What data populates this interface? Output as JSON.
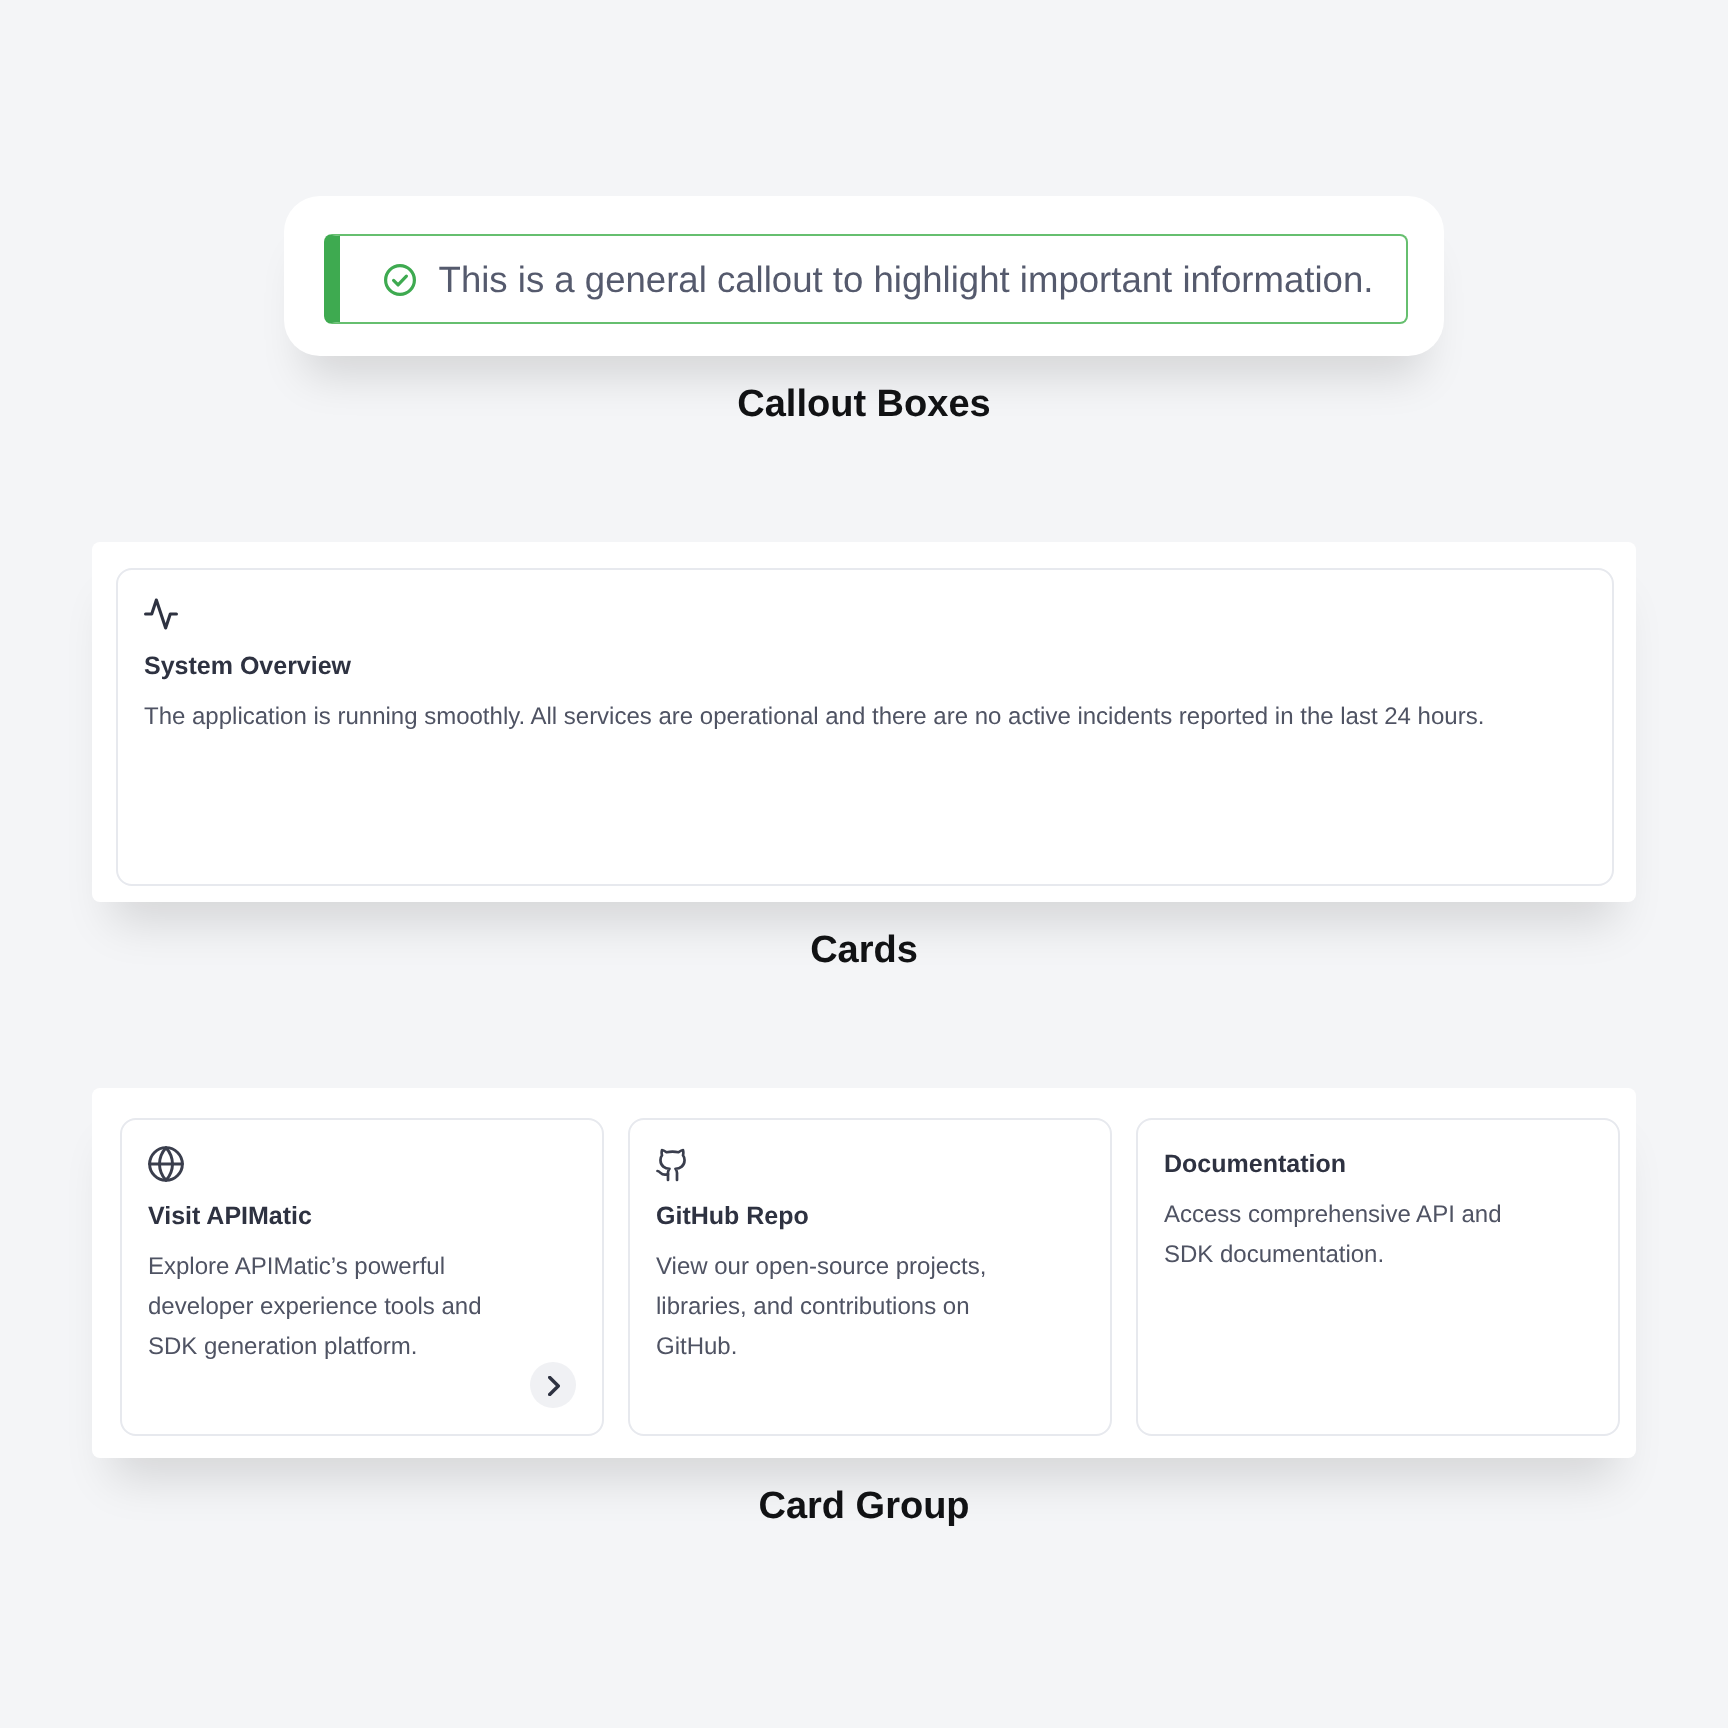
{
  "callout_demo": {
    "callout": {
      "kind": "success",
      "text": "This is a general callout to highlight important information."
    },
    "caption": "Callout Boxes"
  },
  "card_demo": {
    "card": {
      "kind": "status",
      "title": "System Overview",
      "description": "The application is running smoothly. All services are operational and there are no active incidents reported in the last 24 hours."
    },
    "caption": "Cards"
  },
  "card_group_demo": {
    "cards": [
      {
        "kind": "website",
        "title": "Visit APIMatic",
        "description": "Explore APIMatic’s powerful developer experience tools and SDK generation platform."
      },
      {
        "kind": "repository",
        "title": "GitHub Repo",
        "description": "View our open-source projects, libraries, and contributions on GitHub."
      },
      {
        "kind": "plain",
        "title": "Documentation",
        "description": "Access comprehensive API and SDK documentation."
      }
    ],
    "caption": "Card Group"
  }
}
